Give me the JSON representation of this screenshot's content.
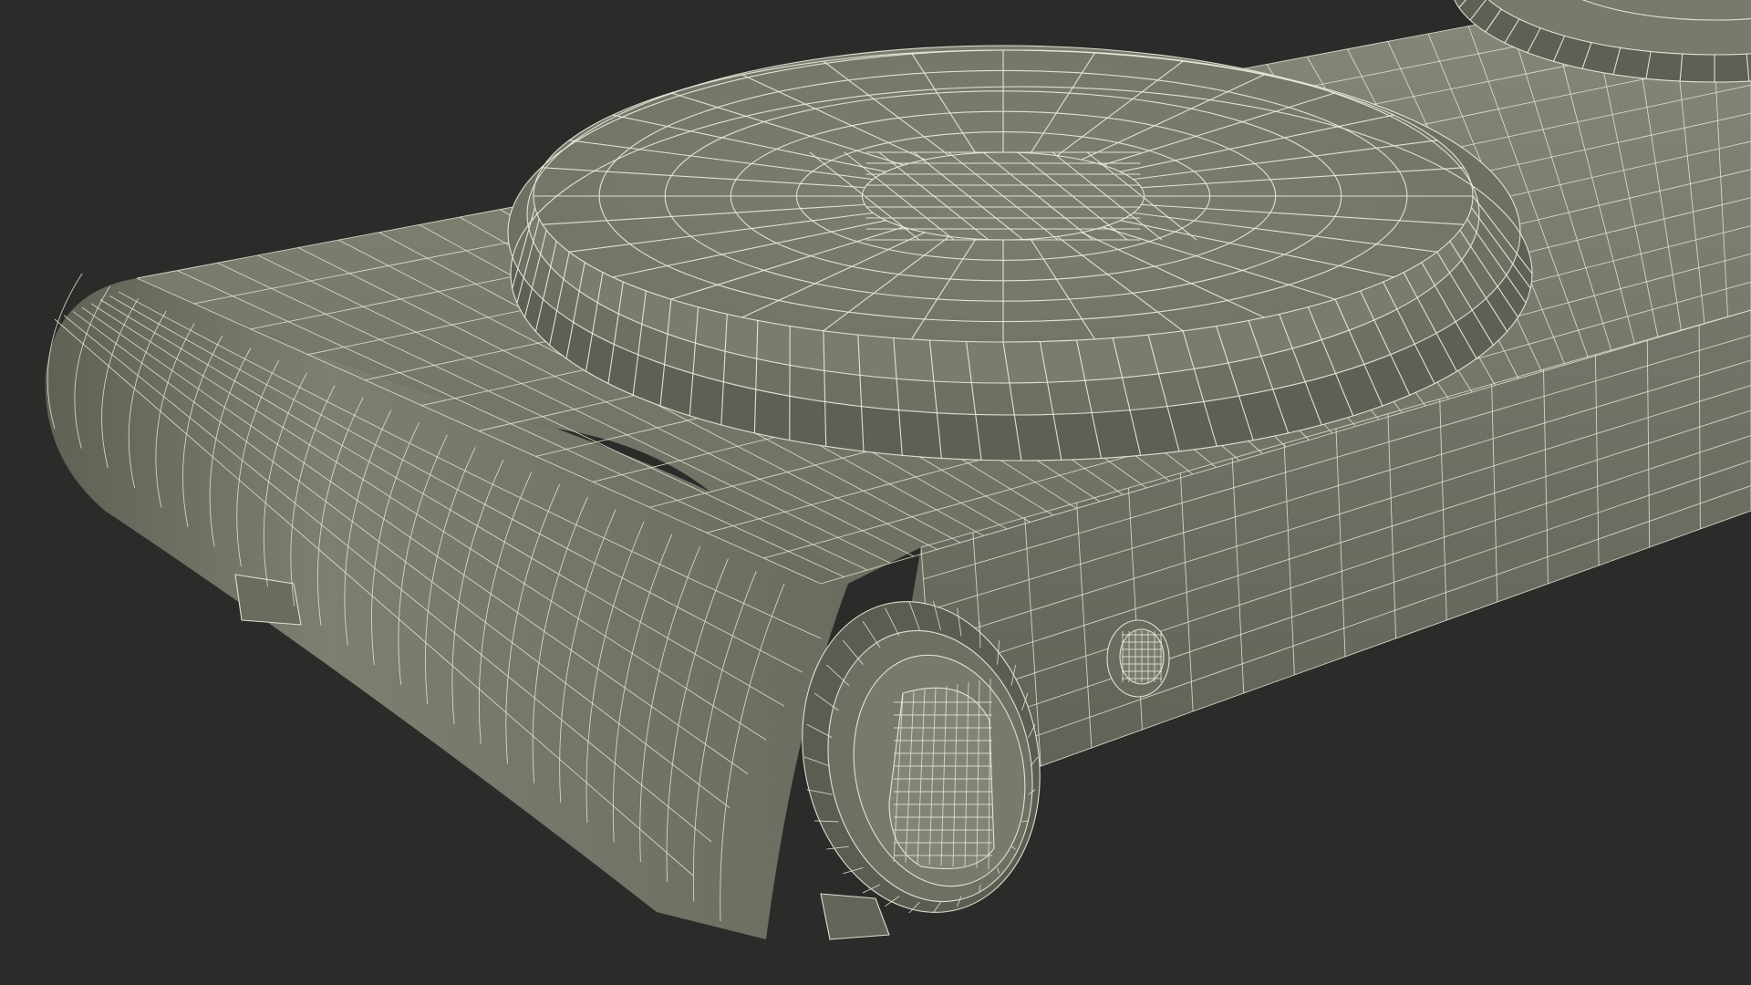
{
  "scene": {
    "subject": "hot-plate-wireframe-model",
    "colors": {
      "background": "#2b2b2a",
      "surface": "#7a7c6e",
      "surface_dark": "#5d5f53",
      "surface_light": "#8d8f80",
      "wire": "#e9ecdc"
    }
  }
}
